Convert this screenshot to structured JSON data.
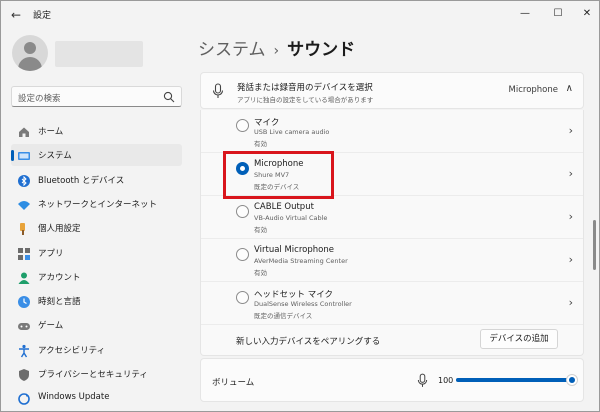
{
  "app": {
    "title": "設定"
  },
  "search": {
    "placeholder": "設定の検索"
  },
  "sidebar": {
    "items": [
      {
        "label": "ホーム",
        "icon": "home-icon"
      },
      {
        "label": "システム",
        "icon": "system-icon",
        "active": true
      },
      {
        "label": "Bluetooth とデバイス",
        "icon": "bluetooth-icon"
      },
      {
        "label": "ネットワークとインターネット",
        "icon": "network-icon"
      },
      {
        "label": "個人用設定",
        "icon": "personalization-icon"
      },
      {
        "label": "アプリ",
        "icon": "apps-icon"
      },
      {
        "label": "アカウント",
        "icon": "account-icon"
      },
      {
        "label": "時刻と言語",
        "icon": "time-language-icon"
      },
      {
        "label": "ゲーム",
        "icon": "gaming-icon"
      },
      {
        "label": "アクセシビリティ",
        "icon": "accessibility-icon"
      },
      {
        "label": "プライバシーとセキュリティ",
        "icon": "privacy-icon"
      },
      {
        "label": "Windows Update",
        "icon": "windows-update-icon"
      }
    ]
  },
  "breadcrumb": {
    "parent": "システム",
    "separator": "›",
    "current": "サウンド"
  },
  "input_section": {
    "title": "発話または録音用のデバイスを選択",
    "subtitle": "アプリに独自の設定をしている場合があります",
    "selected_value": "Microphone"
  },
  "devices": [
    {
      "name": "マイク",
      "detail": "USB Live camera audio",
      "status": "有効",
      "selected": false
    },
    {
      "name": "Microphone",
      "detail": "Shure MV7",
      "status": "既定のデバイス",
      "selected": true
    },
    {
      "name": "CABLE Output",
      "detail": "VB-Audio Virtual Cable",
      "status": "有効",
      "selected": false
    },
    {
      "name": "Virtual Microphone",
      "detail": "AVerMedia Streaming Center",
      "status": "有効",
      "selected": false
    },
    {
      "name": "ヘッドセット マイク",
      "detail": "DualSense Wireless Controller",
      "status": "既定の通信デバイス",
      "selected": false
    }
  ],
  "pair": {
    "label": "新しい入力デバイスをペアリングする",
    "button": "デバイスの追加"
  },
  "volume": {
    "label": "ボリューム",
    "value": "100",
    "level_percent": 100
  },
  "colors": {
    "accent": "#005fb8",
    "highlight": "#d9151c"
  }
}
